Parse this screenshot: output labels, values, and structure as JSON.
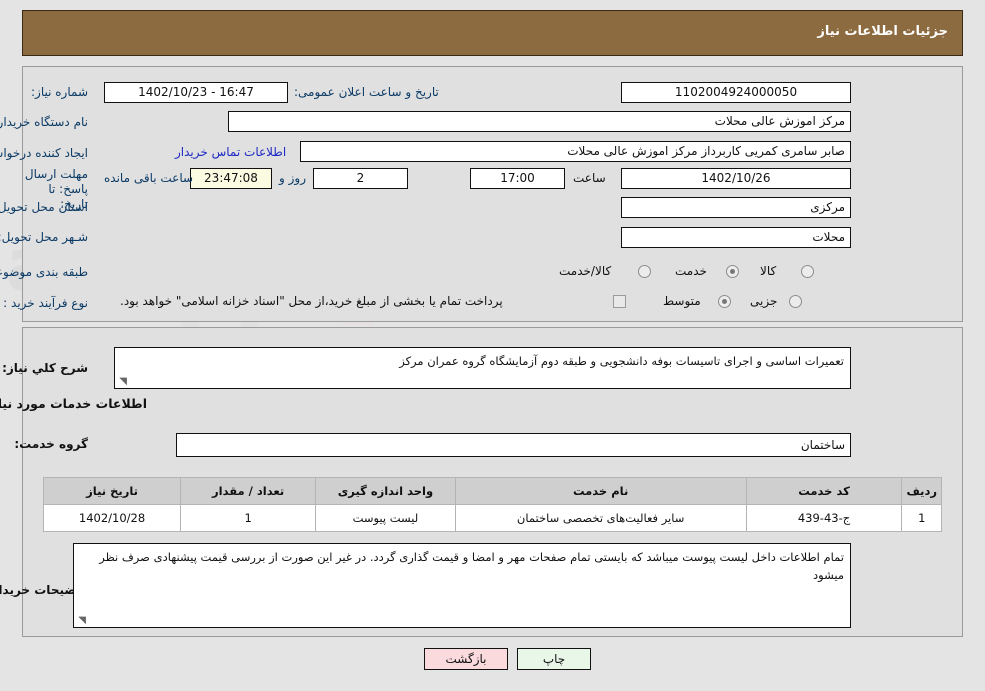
{
  "header": {
    "title": "جزئیات اطلاعات نیاز"
  },
  "watermark": {
    "text": "AriaTender.net"
  },
  "top_form": {
    "need_number_label": "شماره نیاز:",
    "need_number_value": "1102004924000050",
    "public_announce_label": "تاریخ و ساعت اعلان عمومی:",
    "public_announce_value": "16:47 - 1402/10/23",
    "buyer_org_label": "نام دستگاه خریدار:",
    "buyer_org_value": "مرکز اموزش عالی محلات",
    "requester_label": "ایجاد کننده درخواست:",
    "requester_value": "صابر  سامری کمریی کاربرداز مرکز اموزش عالی محلات",
    "buyer_contact_link": "اطلاعات تماس خریدار",
    "deadline_label": "مهلت ارسال پاسخ: تا تاریخ:",
    "deadline_date": "1402/10/26",
    "hour_label": "ساعت",
    "deadline_time": "17:00",
    "days_remaining": "2",
    "days_word": "روز و",
    "time_remaining": "23:47:08",
    "remaining_suffix": "ساعت باقی مانده",
    "province_label": "استان محل تحویل:",
    "province_value": "مرکزی",
    "city_label": "شـهر محل تحویل:",
    "city_value": "محلات",
    "category_label": "طبقه بندی موضوعی:",
    "category_options": [
      "کالا",
      "خدمت",
      "کالا/خدمت"
    ],
    "category_selected": "خدمت",
    "process_label": "نوع فرآیند خرید :",
    "process_options": [
      "جزیی",
      "متوسط"
    ],
    "process_selected": "متوسط",
    "treasury_checkbox_label": "پرداخت تمام یا بخشی از مبلغ خرید،از محل \"اسناد خزانه اسلامی\" خواهد بود.",
    "treasury_checked": false
  },
  "mid_form": {
    "general_desc_label": "شرح کلي نیاز:",
    "general_desc_value": "تعمیرات اساسی و اجرای تاسیسات بوفه دانشجویی و طبقه دوم آزمایشگاه گروه عمران مرکز",
    "services_section_title": "اطلاعات خدمات مورد نیاز",
    "service_group_label": "گروه خدمت:",
    "service_group_value": "ساختمان",
    "buyer_notes_label": "توضیحات خریدار:",
    "buyer_notes_value": "تمام اطلاعات داخل لیست پیوست میباشد که بایستی تمام صفحات مهر و امضا و قیمت گذاری گردد.  در غیر این صورت از بررسی قیمت پیشنهادی صرف نظر میشود"
  },
  "table": {
    "columns": [
      "ردیف",
      "کد خدمت",
      "نام خدمت",
      "واحد اندازه گیری",
      "تعداد / مقدار",
      "تاریخ نیاز"
    ],
    "rows": [
      {
        "row": "1",
        "code": "ج-43-439",
        "name": "سایر فعالیت‌های تخصصی ساختمان",
        "unit": "لیست پیوست",
        "qty": "1",
        "date": "1402/10/28"
      }
    ]
  },
  "footer": {
    "print_label": "چاپ",
    "back_label": "بازگشت"
  }
}
